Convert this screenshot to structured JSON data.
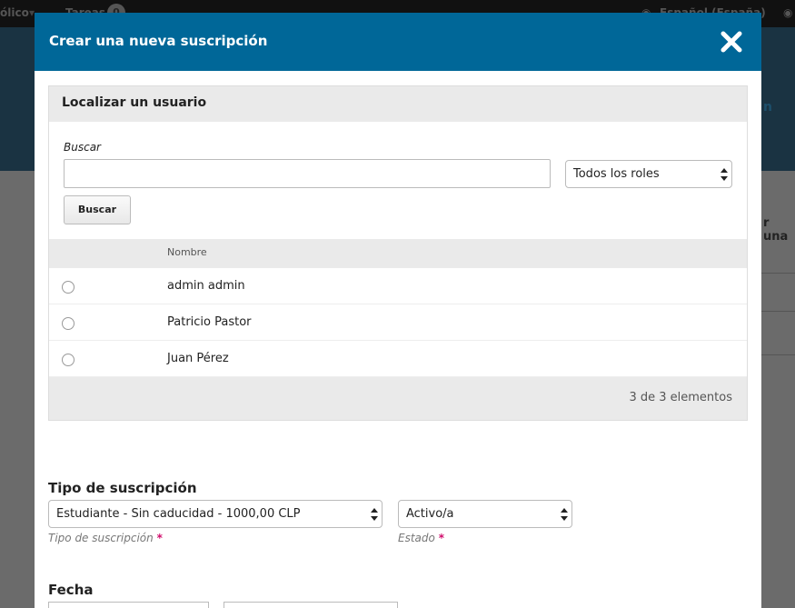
{
  "background": {
    "topbar_left": "ólico",
    "topbar_tasks": "Tareas",
    "topbar_tasks_count": "0",
    "topbar_language": "Español (España)",
    "right_link": "n",
    "right_text": "r una"
  },
  "modal": {
    "title": "Crear una nueva suscripción",
    "close_icon": "close-icon"
  },
  "locate_user": {
    "title": "Localizar un usuario",
    "search_label": "Buscar",
    "search_value": "",
    "role_select": "Todos los roles",
    "search_button": "Buscar",
    "column_header": "Nombre",
    "users": [
      {
        "name": "admin admin"
      },
      {
        "name": "Patricio Pastor"
      },
      {
        "name": "Juan Pérez"
      }
    ],
    "count": "3 de 3 elementos"
  },
  "subscription": {
    "section_title": "Tipo de suscripción",
    "type_value": "Estudiante - Sin caducidad - 1000,00 CLP",
    "type_hint": "Tipo de suscripción",
    "status_value": "Activo/a",
    "status_hint": "Estado",
    "required_mark": "*"
  },
  "date": {
    "section_title": "Fecha"
  },
  "colors": {
    "header_blue": "#006798",
    "required_pink": "#d00b6b"
  }
}
